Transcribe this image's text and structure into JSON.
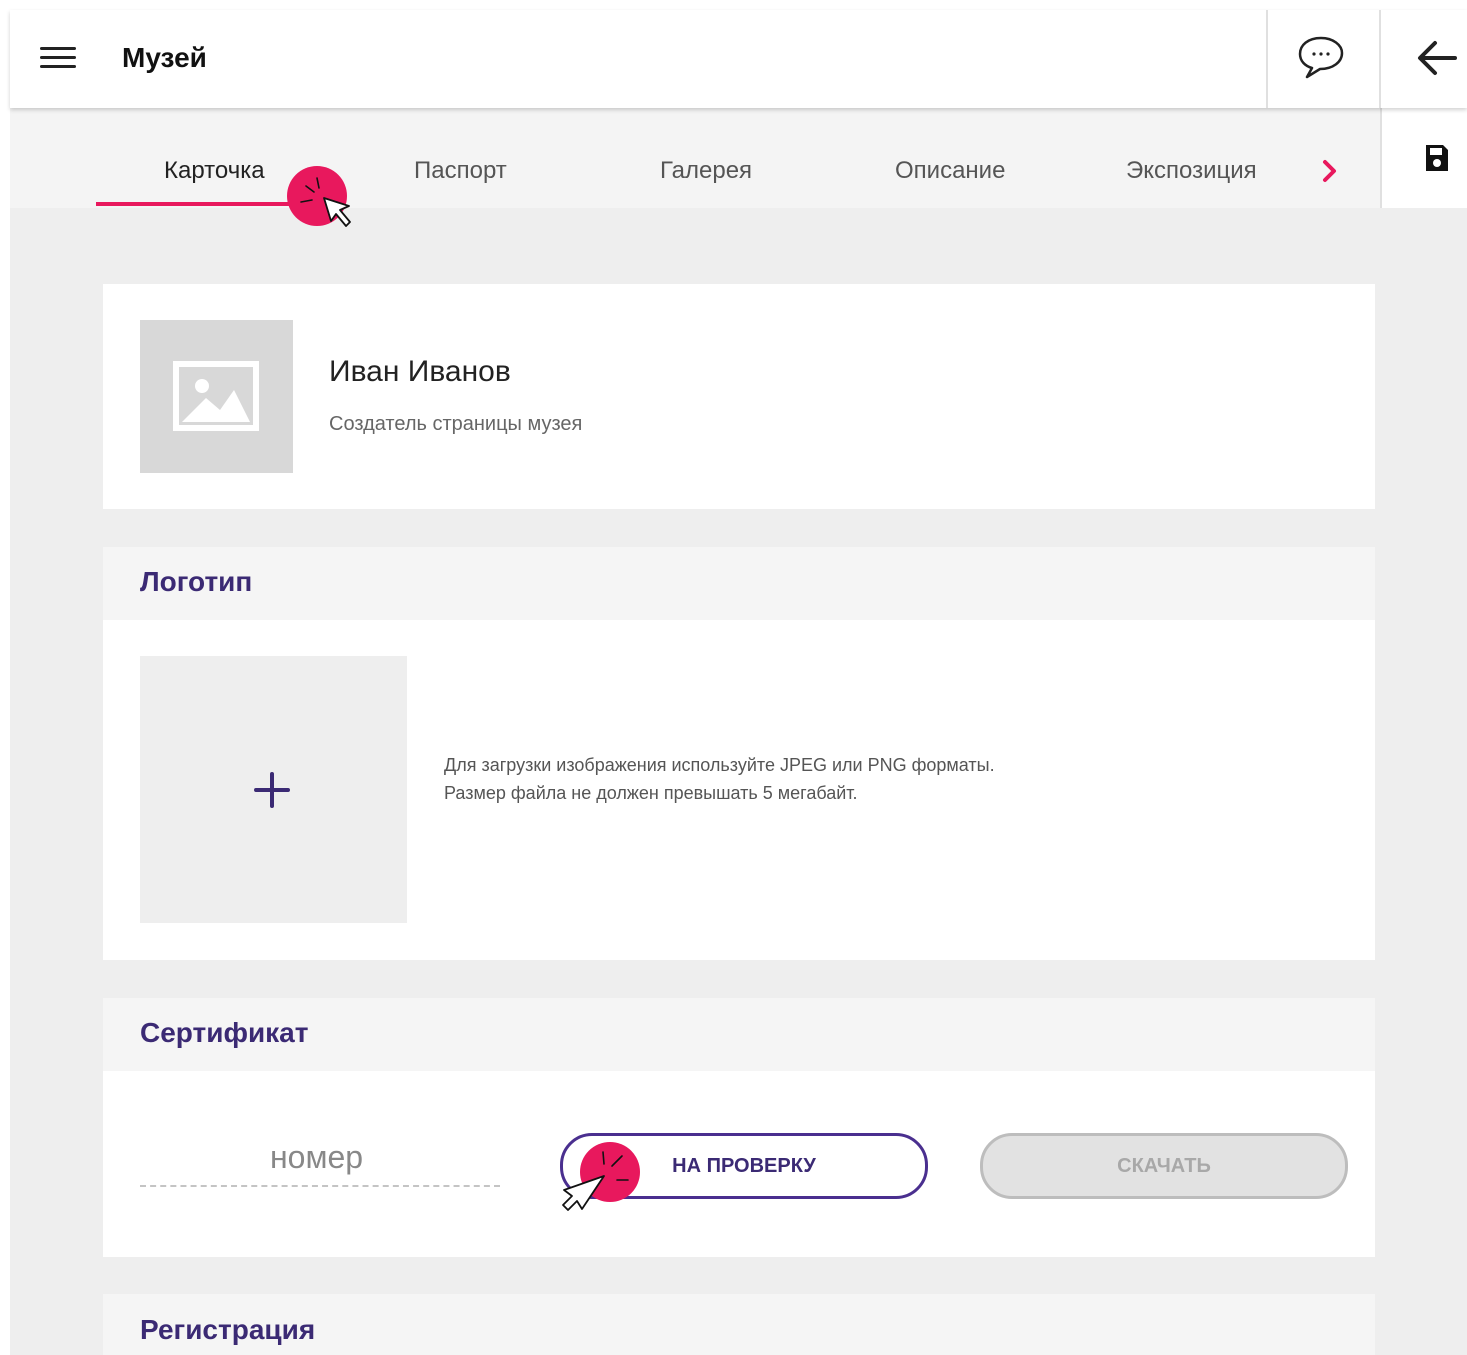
{
  "app": {
    "title": "Музей"
  },
  "tabs": [
    {
      "label": "Карточка",
      "active": true
    },
    {
      "label": "Паспорт"
    },
    {
      "label": "Галерея"
    },
    {
      "label": "Описание"
    },
    {
      "label": "Экспозиция"
    }
  ],
  "icons": {
    "menu": "hamburger-icon",
    "chat": "chat-bubble-icon",
    "back": "arrow-left-icon",
    "save": "floppy-disk-icon",
    "next": "chevron-right-icon",
    "image_placeholder": "image-icon",
    "add": "plus-icon"
  },
  "profile": {
    "name": "Иван Иванов",
    "role": "Создатель страницы музея"
  },
  "logo_section": {
    "title": "Логотип",
    "hint_line1": "Для загрузки изображения используйте JPEG или PNG форматы.",
    "hint_line2": "Размер файла не должен превышать 5 мегабайт."
  },
  "certificate_section": {
    "title": "Сертификат",
    "number_placeholder": "номер",
    "submit_label": "НА ПРОВЕРКУ",
    "download_label": "СКАЧАТЬ"
  },
  "registration_section": {
    "title": "Регистрация"
  },
  "colors": {
    "accent": "#e8185d",
    "primary": "#3b2a74",
    "background": "#eeeeee"
  }
}
